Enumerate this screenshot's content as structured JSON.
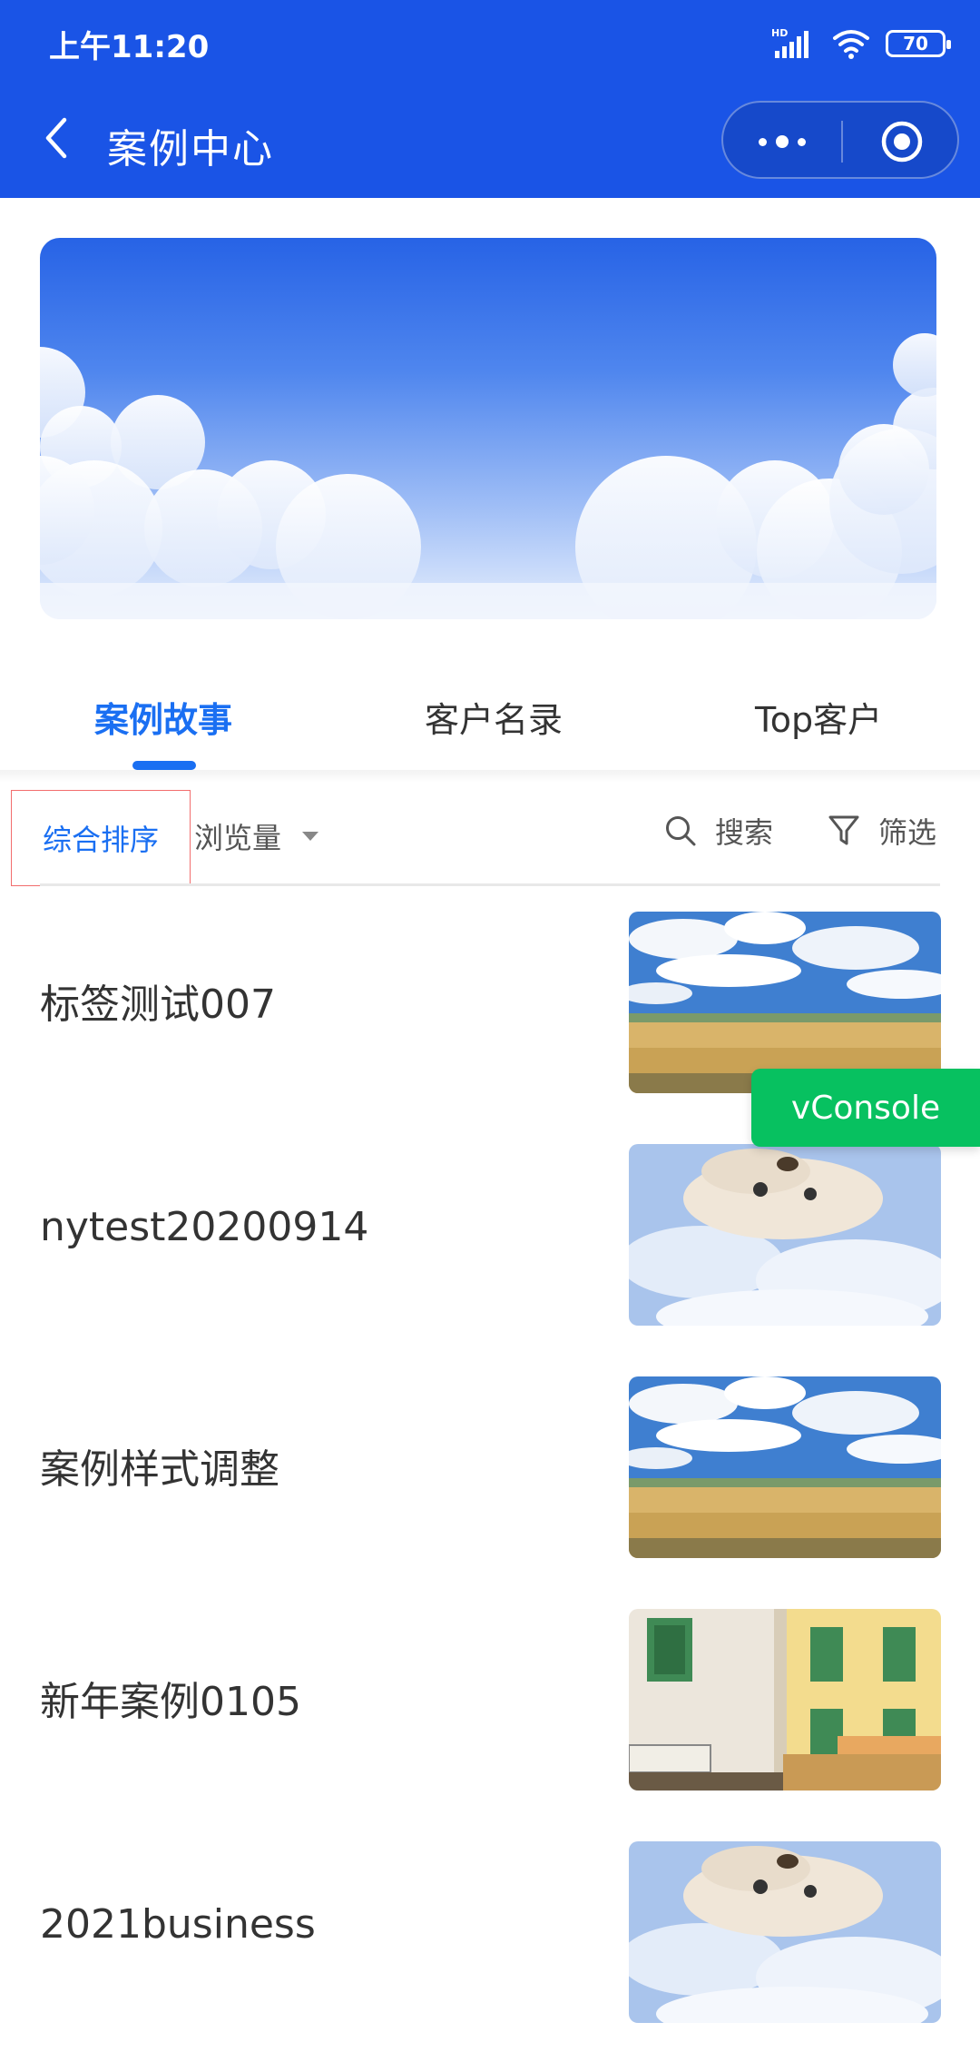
{
  "status_bar": {
    "time": "上午11:20",
    "network": "HD",
    "battery": "70"
  },
  "nav": {
    "title": "案例中心"
  },
  "tabs": [
    {
      "label": "案例故事",
      "active": true
    },
    {
      "label": "客户名录",
      "active": false
    },
    {
      "label": "Top客户",
      "active": false
    }
  ],
  "filters": {
    "sort_label": "综合排序",
    "views_label": "浏览量",
    "search_label": "搜索",
    "filter_label": "筛选"
  },
  "cases": [
    {
      "title": "标签测试007",
      "thumbnail": "wheat-field-sky"
    },
    {
      "title": "nytest20200914",
      "thumbnail": "dog-clouds-flipped"
    },
    {
      "title": "案例样式调整",
      "thumbnail": "wheat-field-sky"
    },
    {
      "title": "新年案例0105",
      "thumbnail": "street-buildings"
    },
    {
      "title": "2021business",
      "thumbnail": "dog-clouds-flipped"
    }
  ],
  "vconsole": {
    "label": "vConsole"
  },
  "colors": {
    "header_bg": "#1a54e6",
    "accent": "#1a6ff2",
    "vconsole_bg": "#07c160",
    "sort_border": "#f26d6d"
  }
}
